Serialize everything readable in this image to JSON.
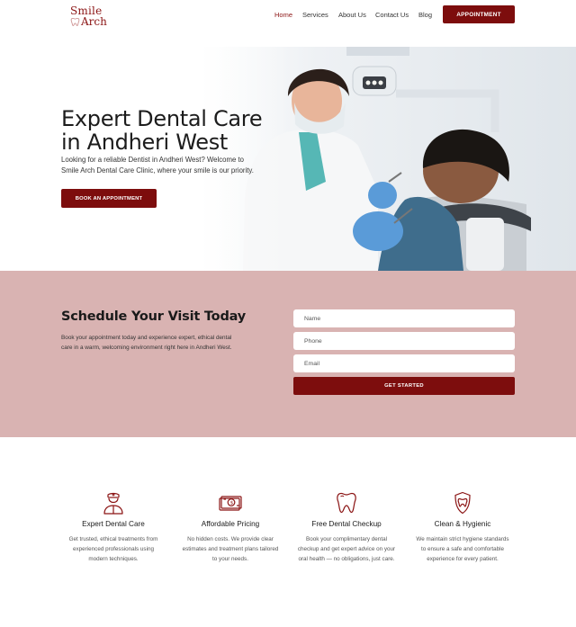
{
  "brand": {
    "logo_top": "Smile",
    "logo_bottom": "Arch"
  },
  "nav": {
    "items": [
      "Home",
      "Services",
      "About Us",
      "Contact Us",
      "Blog"
    ],
    "appointment_label": "APPOINTMENT"
  },
  "hero": {
    "title_line1": "Expert Dental Care",
    "title_line2": "in Andheri West",
    "text": "Looking for a reliable Dentist in Andheri West? Welcome to Smile Arch Dental Care Clinic, where your smile is our priority.",
    "button": "BOOK AN APPOINTMENT"
  },
  "schedule": {
    "title": "Schedule Your Visit Today",
    "text": "Book your appointment today and experience expert, ethical dental care in a warm, welcoming environment right here in Andheri West.",
    "name_placeholder": "Name",
    "phone_placeholder": "Phone",
    "email_placeholder": "Email",
    "button": "GET STARTED"
  },
  "features": [
    {
      "icon": "dentist-icon",
      "title": "Expert Dental Care",
      "text": "Get trusted, ethical treatments from experienced professionals using modern techniques."
    },
    {
      "icon": "money-icon",
      "title": "Affordable Pricing",
      "text": "No hidden costs. We provide clear estimates and treatment plans tailored to your needs."
    },
    {
      "icon": "tooth-icon",
      "title": "Free Dental Checkup",
      "text": "Book your complimentary dental checkup and get expert advice on your oral health — no obligations, just care."
    },
    {
      "icon": "hygiene-icon",
      "title": "Clean & Hygienic",
      "text": "We maintain strict hygiene standards to ensure a safe and comfortable experience for every patient."
    }
  ],
  "colors": {
    "brand": "#7d0d0d",
    "schedule_bg": "#d9b3b2"
  }
}
